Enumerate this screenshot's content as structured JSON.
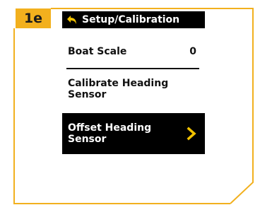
{
  "step_badge": "1e",
  "header": {
    "title": "Setup/Calibration",
    "back_icon": "back-arrow-icon"
  },
  "menu": {
    "items": [
      {
        "label": "Boat Scale",
        "value": "0"
      },
      {
        "label": "Calibrate Heading Sensor"
      },
      {
        "label": "Offset Heading Sensor",
        "selected": true,
        "icon": "chevron-right-icon"
      }
    ]
  },
  "colors": {
    "accent": "#f2b01e",
    "selected_bg": "#000000",
    "selected_fg": "#ffffff",
    "chevron": "#f2c200"
  }
}
